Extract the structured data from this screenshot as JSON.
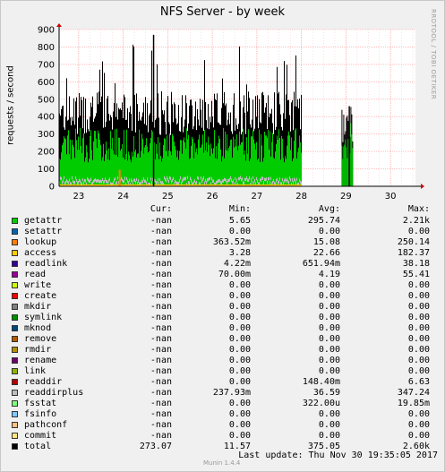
{
  "title": "NFS Server - by week",
  "ylabel": "requests / second",
  "side_text": "RRDTOOL / TOBI OETIKER",
  "legend_headers": [
    "Cur:",
    "Min:",
    "Avg:",
    "Max:"
  ],
  "legend": [
    {
      "name": "getattr",
      "color": "#00cc00",
      "cur": "-nan",
      "min": "5.65",
      "avg": "295.74",
      "max": "2.21k"
    },
    {
      "name": "setattr",
      "color": "#0066b3",
      "cur": "-nan",
      "min": "0.00",
      "avg": "0.00",
      "max": "0.00"
    },
    {
      "name": "lookup",
      "color": "#ff8000",
      "cur": "-nan",
      "min": "363.52m",
      "avg": "15.08",
      "max": "250.14"
    },
    {
      "name": "access",
      "color": "#ffcc00",
      "cur": "-nan",
      "min": "3.28",
      "avg": "22.66",
      "max": "182.37"
    },
    {
      "name": "readlink",
      "color": "#330099",
      "cur": "-nan",
      "min": "4.22m",
      "avg": "651.94m",
      "max": "38.18"
    },
    {
      "name": "read",
      "color": "#990099",
      "cur": "-nan",
      "min": "70.00m",
      "avg": "4.19",
      "max": "55.41"
    },
    {
      "name": "write",
      "color": "#ccff00",
      "cur": "-nan",
      "min": "0.00",
      "avg": "0.00",
      "max": "0.00"
    },
    {
      "name": "create",
      "color": "#ff0000",
      "cur": "-nan",
      "min": "0.00",
      "avg": "0.00",
      "max": "0.00"
    },
    {
      "name": "mkdir",
      "color": "#808080",
      "cur": "-nan",
      "min": "0.00",
      "avg": "0.00",
      "max": "0.00"
    },
    {
      "name": "symlink",
      "color": "#008f00",
      "cur": "-nan",
      "min": "0.00",
      "avg": "0.00",
      "max": "0.00"
    },
    {
      "name": "mknod",
      "color": "#00487d",
      "cur": "-nan",
      "min": "0.00",
      "avg": "0.00",
      "max": "0.00"
    },
    {
      "name": "remove",
      "color": "#b35a00",
      "cur": "-nan",
      "min": "0.00",
      "avg": "0.00",
      "max": "0.00"
    },
    {
      "name": "rmdir",
      "color": "#b38f00",
      "cur": "-nan",
      "min": "0.00",
      "avg": "0.00",
      "max": "0.00"
    },
    {
      "name": "rename",
      "color": "#6b006b",
      "cur": "-nan",
      "min": "0.00",
      "avg": "0.00",
      "max": "0.00"
    },
    {
      "name": "link",
      "color": "#8fb300",
      "cur": "-nan",
      "min": "0.00",
      "avg": "0.00",
      "max": "0.00"
    },
    {
      "name": "readdir",
      "color": "#b30000",
      "cur": "-nan",
      "min": "0.00",
      "avg": "148.40m",
      "max": "6.63"
    },
    {
      "name": "readdirplus",
      "color": "#bebebe",
      "cur": "-nan",
      "min": "237.93m",
      "avg": "36.59",
      "max": "347.24"
    },
    {
      "name": "fsstat",
      "color": "#80ff80",
      "cur": "-nan",
      "min": "0.00",
      "avg": "322.00u",
      "max": "19.85m"
    },
    {
      "name": "fsinfo",
      "color": "#80c9ff",
      "cur": "-nan",
      "min": "0.00",
      "avg": "0.00",
      "max": "0.00"
    },
    {
      "name": "pathconf",
      "color": "#ffc080",
      "cur": "-nan",
      "min": "0.00",
      "avg": "0.00",
      "max": "0.00"
    },
    {
      "name": "commit",
      "color": "#ffe680",
      "cur": "-nan",
      "min": "0.00",
      "avg": "0.00",
      "max": "0.00"
    },
    {
      "name": "total",
      "color": "#000000",
      "cur": "273.07",
      "min": "11.57",
      "avg": "375.05",
      "max": "2.60k"
    }
  ],
  "last_update": "Last update:  Thu Nov 30 19:35:05 2017",
  "munin_version": "Munin 1.4.4",
  "chart_data": {
    "type": "area",
    "title": "NFS Server - by week",
    "ylabel": "requests / second",
    "ylim": [
      0,
      900
    ],
    "yticks": [
      0,
      100,
      200,
      300,
      400,
      500,
      600,
      700,
      800,
      900
    ],
    "xticks": [
      "23",
      "24",
      "25",
      "26",
      "27",
      "28",
      "29",
      "30"
    ],
    "grid": true,
    "background": "#ffffff",
    "grid_color": "#ff9999",
    "segments": [
      {
        "x_start": 22.56,
        "x_end": 28.0,
        "total_peak": 870,
        "total_typical": 420,
        "getattr_typical": 250
      },
      {
        "x_start": 28.9,
        "x_end": 29.15,
        "total_peak": 460,
        "total_typical": 360,
        "getattr_typical": 270
      }
    ]
  }
}
